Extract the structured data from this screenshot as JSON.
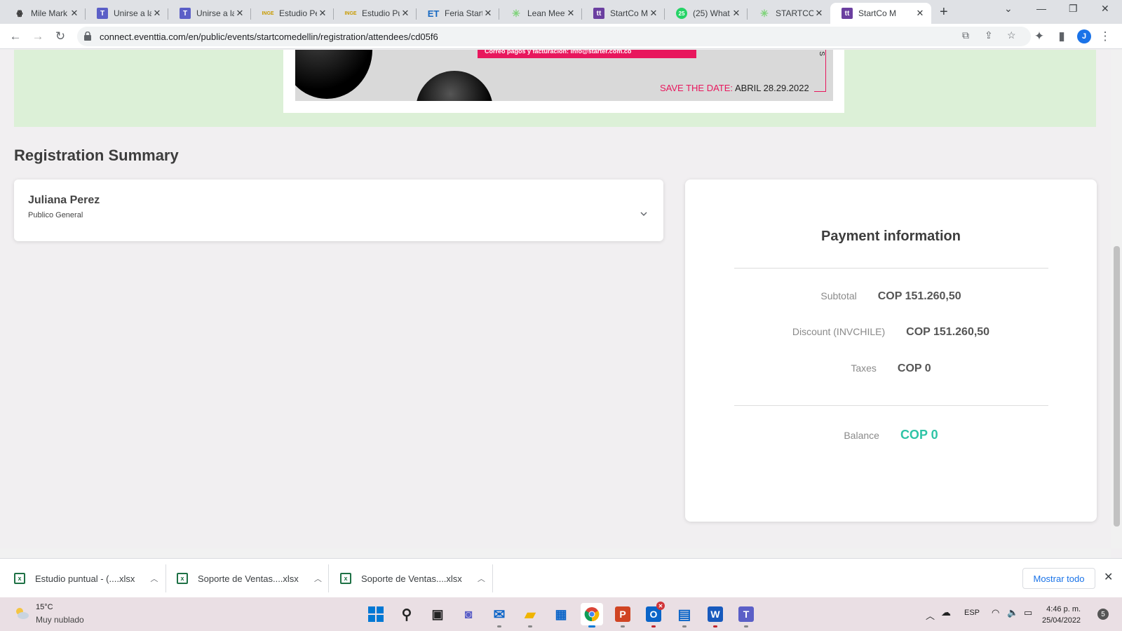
{
  "browser": {
    "tabs": [
      {
        "title": "Mile Mark",
        "icon": "mile-markers-icon",
        "color": "#222222"
      },
      {
        "title": "Unirse a la",
        "icon": "teams-icon",
        "color": "#5b5fc7"
      },
      {
        "title": "Unirse a la",
        "icon": "teams-icon",
        "color": "#5b5fc7"
      },
      {
        "title": "Estudio Pe",
        "icon": "inge-icon",
        "color": "#c89b00"
      },
      {
        "title": "Estudio Pu",
        "icon": "inge-icon",
        "color": "#c89b00"
      },
      {
        "title": "Feria Start",
        "icon": "et-icon",
        "color": "#1769c2"
      },
      {
        "title": "Lean Meet",
        "icon": "leaf-icon",
        "color": "#7fd37a"
      },
      {
        "title": "StartCo M",
        "icon": "eventtia-icon",
        "color": "#6b3fa0"
      },
      {
        "title": "(25) What",
        "icon": "whatsapp-icon",
        "color": "#25d366"
      },
      {
        "title": "STARTCO -",
        "icon": "leaf-icon",
        "color": "#7fd37a"
      },
      {
        "title": "StartCo M",
        "icon": "eventtia-icon",
        "color": "#6b3fa0"
      }
    ],
    "active_tab": 10,
    "url": "connect.eventtia.com/en/public/events/startcomedellin/registration/attendees/cd05f6",
    "profile_initial": "J"
  },
  "banner": {
    "pink_strip_text": "Correo pagos y facturación: info@starter.com.co",
    "save_the_date_label": "SAVE THE DATE:",
    "save_the_date_value": "ABRIL 28.29.2022",
    "side_letter": "S"
  },
  "summary": {
    "title": "Registration Summary",
    "attendee": {
      "name": "Juliana Perez",
      "type": "Publico General"
    }
  },
  "payment": {
    "title": "Payment information",
    "rows": [
      {
        "label": "Subtotal",
        "value": "COP 151.260,50"
      },
      {
        "label": "Discount (INVCHILE)",
        "value": "COP 151.260,50"
      },
      {
        "label": "Taxes",
        "value": "COP 0"
      }
    ],
    "balance": {
      "label": "Balance",
      "value": "COP 0"
    },
    "accent_color": "#2ec4a6"
  },
  "downloads": {
    "items": [
      {
        "name": "Estudio puntual - (....xlsx"
      },
      {
        "name": "Soporte de Ventas....xlsx"
      },
      {
        "name": "Soporte de Ventas....xlsx"
      }
    ],
    "show_all": "Mostrar todo"
  },
  "taskbar": {
    "weather": {
      "temp": "15°C",
      "desc": "Muy nublado"
    },
    "language": "ESP",
    "time": "4:46 p. m.",
    "date": "25/04/2022",
    "notifications": "5"
  }
}
